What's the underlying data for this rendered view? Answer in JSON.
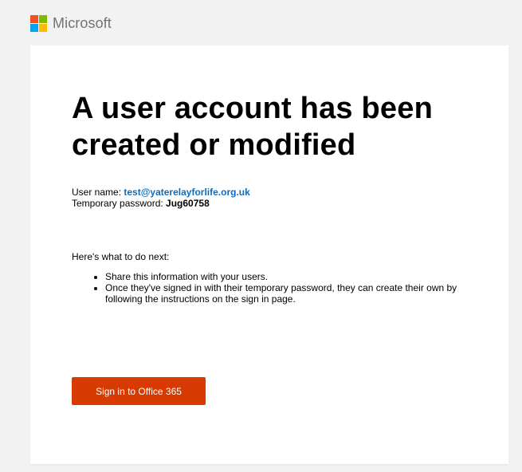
{
  "brand": {
    "name": "Microsoft",
    "logo_colors": [
      "#f25022",
      "#7fba00",
      "#00a4ef",
      "#ffb900"
    ]
  },
  "email": {
    "headline": "A user account has been created or modified",
    "username_label": "User name:",
    "username_value": "test@yaterelayforlife.org.uk",
    "password_label": "Temporary password:",
    "password_value": "Jug60758",
    "next_steps_title": "Here's what to do next:",
    "steps": [
      "Share this information with your users.",
      "Once they've signed in with their temporary password, they can create their own by following the instructions on the sign in page."
    ],
    "cta_label": "Sign in to Office 365"
  },
  "colors": {
    "link": "#0f6cbd",
    "button": "#d83b01",
    "background": "#f2f2f2"
  }
}
